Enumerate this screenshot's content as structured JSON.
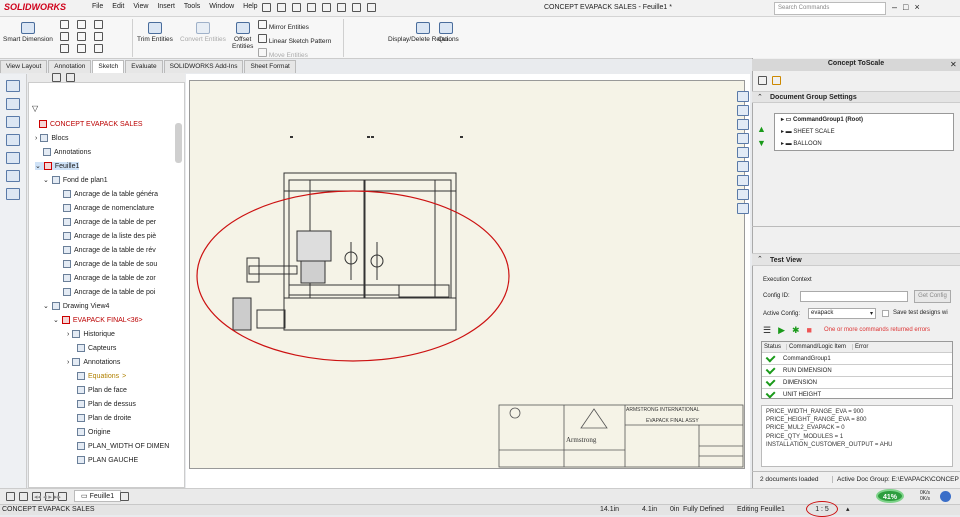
{
  "app": {
    "logo": "SOLIDWORKS",
    "window_title": "CONCEPT EVAPACK SALES - Feuille1 *",
    "search_placeholder": "Search Commands"
  },
  "menu": [
    "File",
    "Edit",
    "View",
    "Insert",
    "Tools",
    "Window",
    "Help"
  ],
  "ribbon": {
    "smart_dimension": "Smart Dimension",
    "trim_entities": "Trim Entities",
    "convert_entities": "Convert Entities",
    "offset_entities_1": "Offset",
    "offset_entities_2": "Entities",
    "mirror_entities": "Mirror Entities",
    "linear_sketch_pattern": "Linear Sketch Pattern",
    "move_entities": "Move Entities",
    "display_delete_relations": "Display/Delete Relations",
    "quick": "Qui..."
  },
  "tabs": [
    "View Layout",
    "Annotation",
    "Sketch",
    "Evaluate",
    "SOLIDWORKS Add-Ins",
    "Sheet Format"
  ],
  "tree": {
    "root": "CONCEPT EVAPACK SALES",
    "items": [
      "Blocs",
      "Annotations",
      "Feuille1",
      "Fond de plan1",
      "Ancrage de la table généra",
      "Ancrage de nomenclature",
      "Ancrage de la table de per",
      "Ancrage de la liste des piè",
      "Ancrage de la table de rév",
      "Ancrage de la table de sou",
      "Ancrage de la table de zor",
      "Ancrage de la table de poi",
      "Drawing View4",
      "EVAPACK FINAL<36>",
      "Historique",
      "Capteurs",
      "Annotations",
      "Equations",
      "Plan de face",
      "Plan de dessus",
      "Plan de droite",
      "Origine",
      "PLAN_WIDTH OF DIMEN",
      "PLAN GAUCHE"
    ],
    "equations_suffix": ">",
    "bottom_tab": "Feuille1"
  },
  "title_block": {
    "company": "ARMSTRONG INTERNATIONAL",
    "drawing_name": "EVAPACK FINAL ASSY",
    "logo_text": "Armstrong"
  },
  "right_panel": {
    "header": "Concept ToScale",
    "doc_group_settings": "Document Group Settings",
    "groups": [
      "CommandGroup1 (Root)",
      "SHEET SCALE",
      "BALLOON"
    ],
    "test_view": "Test View",
    "execution_context": "Execution Context",
    "config_id_label": "Config ID:",
    "get_config": "Get Config",
    "active_config_label": "Active Config:",
    "active_config_value": "evapack",
    "save_label": "Save test designs wi",
    "error_text": "One or more commands returned errors",
    "columns": [
      "Status",
      "Command/Logic Item",
      "Error"
    ],
    "commands": [
      "CommandGroup1",
      "RUN DIMENSION",
      "DIMENSION",
      "UNIT HEIGHT"
    ],
    "log": [
      "PRICE_WIDTH_RANGE_EVA = 900",
      "PRICE_HEIGHT_RANGE_EVA = 800",
      "PRICE_MUL2_EVAPACK = 0",
      "PRICE_QTY_MODULES = 1",
      "INSTALLATION_CUSTOMER_OUTPUT = AHU"
    ],
    "docs_loaded": "2 documents loaded",
    "active_group": "Active Doc Group: E:\\EVAPACK\\CONCEP"
  },
  "status": {
    "doc": "CONCEPT EVAPACK SALES",
    "x": "14.1in",
    "y": "4.1in",
    "z": "0in",
    "defined": "Fully Defined",
    "editing": "Editing Feuille1",
    "scale": "1 : 5",
    "cpu": "41%",
    "net_up": "0K/s",
    "net_down": "0K/s"
  },
  "colors": {
    "accent_red": "#d0021b",
    "sheet": "#f5f3e7",
    "annotation_circle": "#cc1111"
  }
}
